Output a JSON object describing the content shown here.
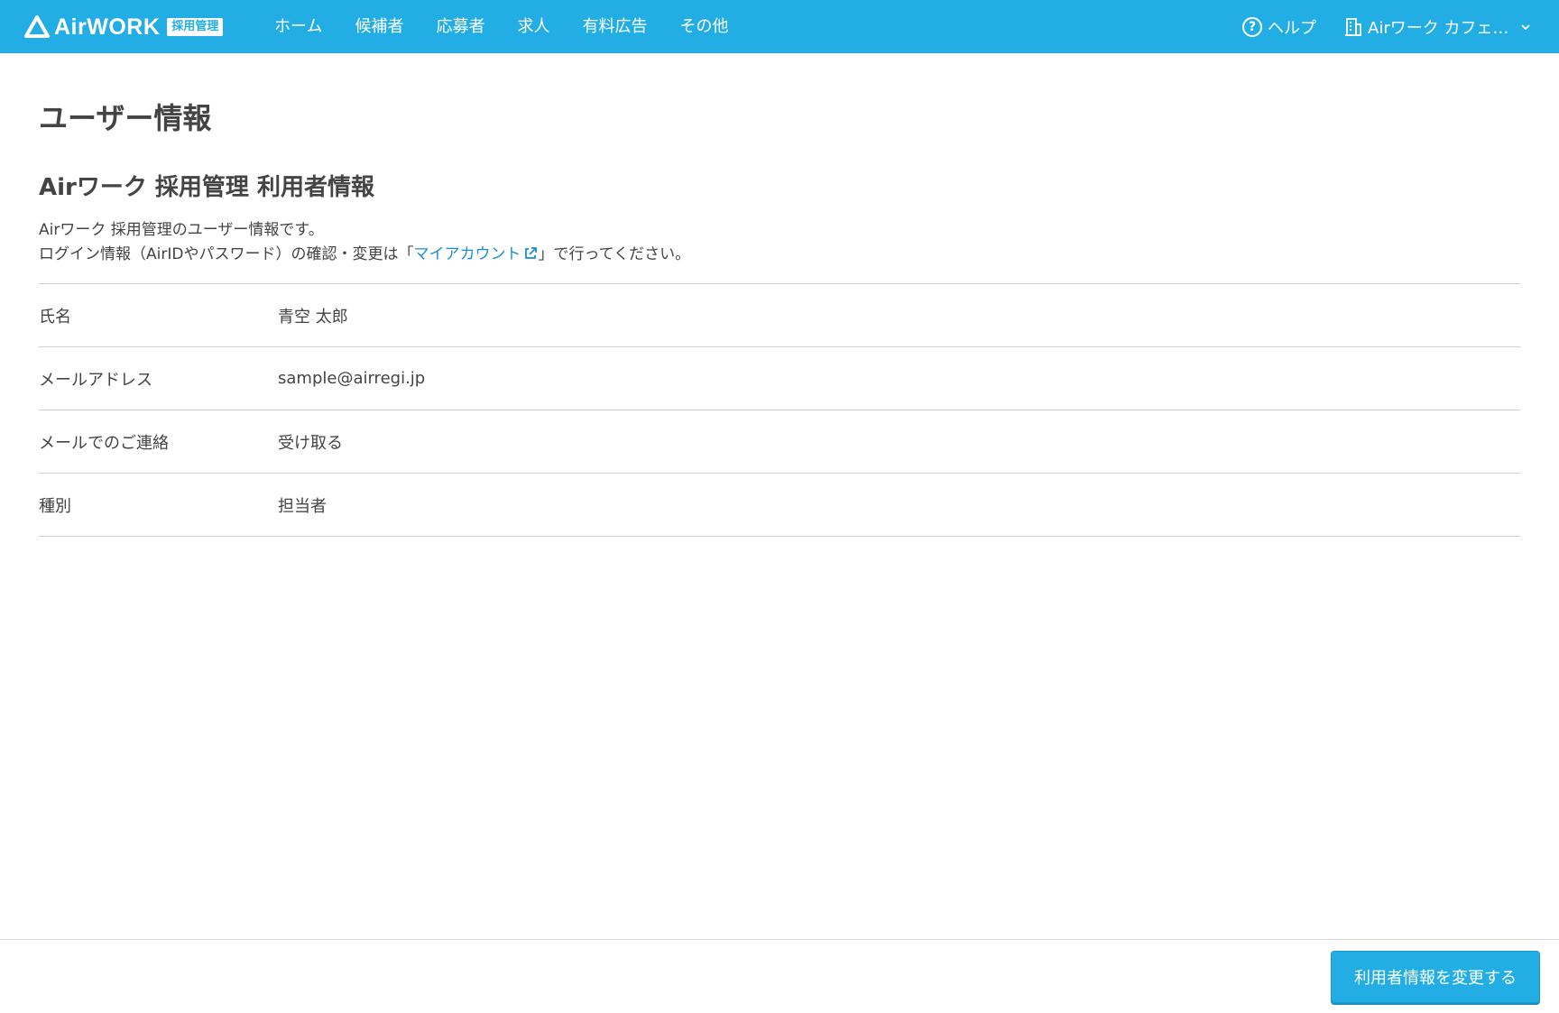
{
  "header": {
    "logo_text": "AirWORK",
    "logo_badge": "採用管理",
    "nav": [
      "ホーム",
      "候補者",
      "応募者",
      "求人",
      "有料広告",
      "その他"
    ],
    "help_label": "ヘルプ",
    "store_label": "Airワーク カフェ…",
    "icons": {
      "logo": "airwork-logo-icon",
      "help": "help-circle-icon",
      "store": "building-icon",
      "dropdown": "chevron-down-icon"
    }
  },
  "page": {
    "title": "ユーザー情報",
    "section_title": "Airワーク 採用管理 利用者情報",
    "desc_line1": "Airワーク 採用管理のユーザー情報です。",
    "desc_line2_before": "ログイン情報（AirIDやパスワード）の確認・変更は「",
    "desc_link": "マイアカウント",
    "desc_line2_after": "」で行ってください。"
  },
  "user_info": {
    "rows": [
      {
        "label": "氏名",
        "value": "青空 太郎"
      },
      {
        "label": "メールアドレス",
        "value": "sample@airregi.jp"
      },
      {
        "label": "メールでのご連絡",
        "value": "受け取る"
      },
      {
        "label": "種別",
        "value": "担当者"
      }
    ]
  },
  "footer": {
    "edit_button": "利用者情報を変更する"
  },
  "colors": {
    "header_bg": "#22aee4",
    "link": "#1a8fcf",
    "button_bg": "#22aee4"
  }
}
